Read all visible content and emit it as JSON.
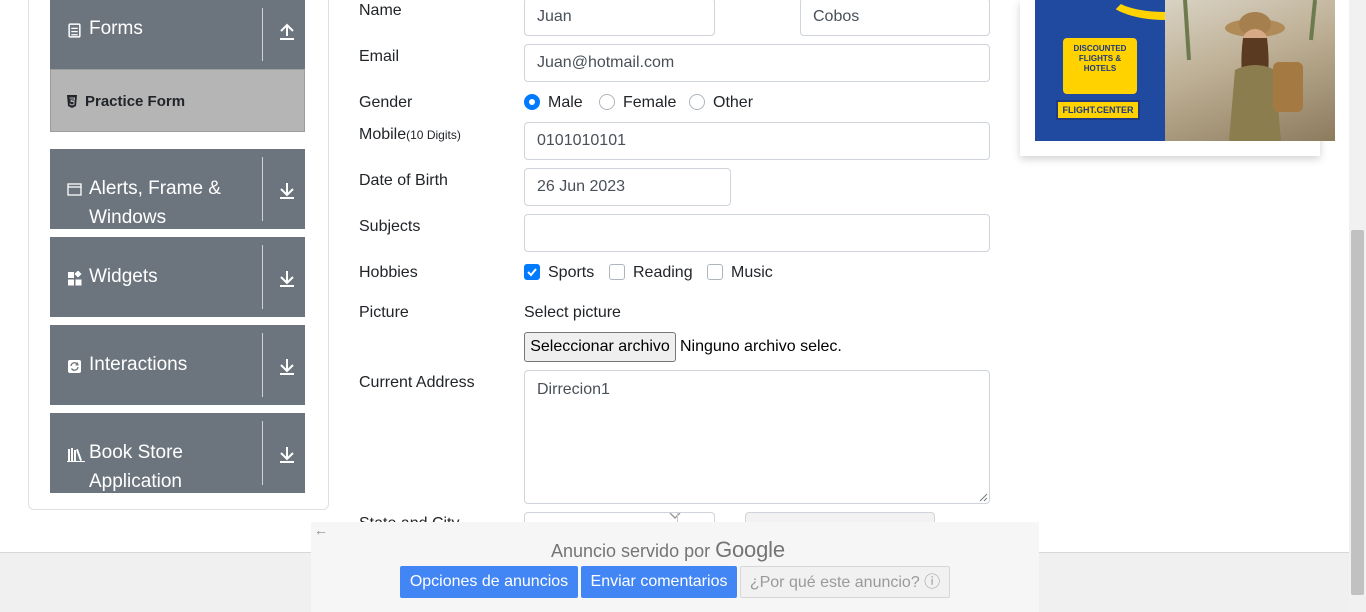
{
  "sidebar": {
    "groups": [
      {
        "label": "Forms",
        "icon": "document-icon",
        "arrow": "upload-arrow-icon"
      },
      {
        "label": "Alerts, Frame &",
        "label2": "Windows",
        "icon": "window-icon",
        "arrow": "download-arrow-icon"
      },
      {
        "label": "Widgets",
        "icon": "widgets-icon",
        "arrow": "download-arrow-icon"
      },
      {
        "label": "Interactions",
        "icon": "refresh-icon",
        "arrow": "download-arrow-icon"
      },
      {
        "label": "Book Store",
        "label2": "Application",
        "icon": "books-icon",
        "arrow": "download-arrow-icon"
      }
    ],
    "active_item": "Practice Form"
  },
  "form": {
    "name_label": "Name",
    "first_name": "Juan",
    "last_name": "Cobos",
    "email_label": "Email",
    "email": "Juan@hotmail.com",
    "gender_label": "Gender",
    "gender_options": [
      "Male",
      "Female",
      "Other"
    ],
    "gender_selected": "Male",
    "mobile_label": "Mobile",
    "mobile_hint": "(10 Digits)",
    "mobile": "0101010101",
    "dob_label": "Date of Birth",
    "dob": "26 Jun 2023",
    "subjects_label": "Subjects",
    "subjects": "",
    "hobbies_label": "Hobbies",
    "hobbies": [
      "Sports",
      "Reading",
      "Music"
    ],
    "hobbies_checked": [
      "Sports"
    ],
    "picture_label": "Picture",
    "picture_prompt": "Select picture",
    "file_button": "Seleccionar archivo",
    "file_status": "Ninguno archivo selec.",
    "address_label": "Current Address",
    "address": "Dirrecion1",
    "state_city_label": "State and City"
  },
  "top_ad": {
    "badge": "DISCOUNTED FLIGHTS & HOTELS",
    "brand": "FLIGHT.CENTER"
  },
  "google_bar": {
    "served_by": "Anuncio servido por",
    "google": "Google",
    "ad_options": "Opciones de anuncios",
    "send_feedback": "Enviar comentarios",
    "why_ad": "¿Por qué este anuncio? ⓘ"
  },
  "colors": {
    "sidebar_group": "#6c757d",
    "active_item_bg": "#b5b5b5",
    "accent": "#007bff",
    "google_blue": "#4285f4"
  }
}
